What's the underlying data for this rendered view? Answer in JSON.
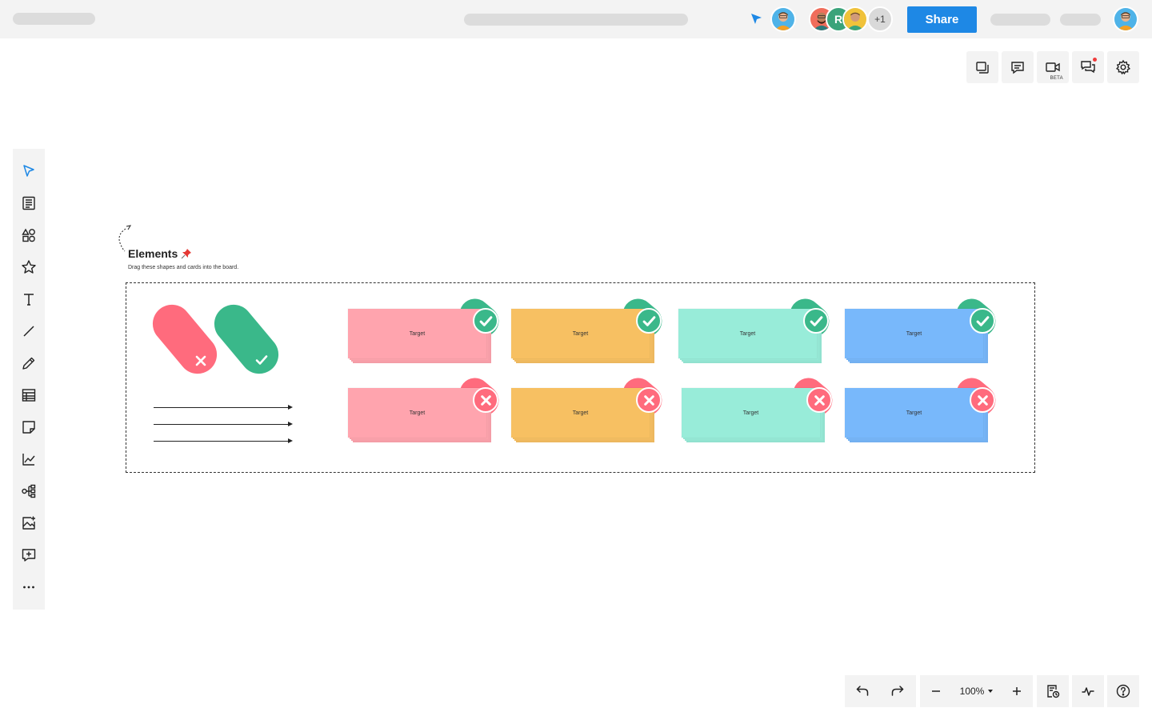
{
  "topbar": {
    "share_label": "Share",
    "collaborators": [
      {
        "type": "photo",
        "name": "collaborator-1"
      },
      {
        "type": "letter",
        "letter": "R"
      },
      {
        "type": "photo",
        "name": "collaborator-3"
      }
    ],
    "more_count": "+1"
  },
  "right_tools": [
    {
      "icon": "frames-icon"
    },
    {
      "icon": "comment-icon"
    },
    {
      "icon": "video-icon",
      "badge": "BETA"
    },
    {
      "icon": "chat-icon",
      "notification": true
    },
    {
      "icon": "gear-icon"
    }
  ],
  "left_tools": [
    {
      "icon": "select-cursor-icon",
      "active": true
    },
    {
      "icon": "template-icon"
    },
    {
      "icon": "shapes-icon"
    },
    {
      "icon": "star-icon"
    },
    {
      "icon": "text-icon"
    },
    {
      "icon": "line-icon"
    },
    {
      "icon": "pencil-icon"
    },
    {
      "icon": "table-icon"
    },
    {
      "icon": "sticky-note-icon"
    },
    {
      "icon": "chart-icon"
    },
    {
      "icon": "mindmap-icon"
    },
    {
      "icon": "image-icon"
    },
    {
      "icon": "add-comment-icon"
    },
    {
      "icon": "more-icon"
    }
  ],
  "canvas": {
    "frame_title": "Elements",
    "frame_subtitle": "Drag these shapes and cards into the board.",
    "cards": [
      {
        "label": "Target",
        "color": "#ffa4ae",
        "status": "check"
      },
      {
        "label": "Target",
        "color": "#f7c062",
        "status": "check"
      },
      {
        "label": "Target",
        "color": "#98ecd9",
        "status": "check"
      },
      {
        "label": "Target",
        "color": "#78b8fb",
        "status": "check"
      },
      {
        "label": "Target",
        "color": "#ffa4ae",
        "status": "cross"
      },
      {
        "label": "Target",
        "color": "#f7c062",
        "status": "cross"
      },
      {
        "label": "Target",
        "color": "#98ecd9",
        "status": "cross"
      },
      {
        "label": "Target",
        "color": "#78b8fb",
        "status": "cross"
      }
    ]
  },
  "bottom_bar": {
    "zoom": "100%"
  },
  "colors": {
    "accent": "#1e88e5",
    "check": "#3ab88a",
    "cross": "#ff6b7d",
    "toolbar_bg": "#f3f3f3"
  }
}
